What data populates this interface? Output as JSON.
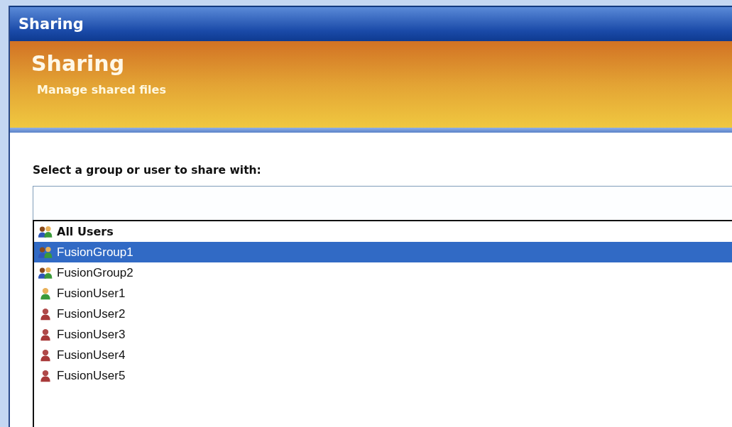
{
  "window": {
    "title": "Sharing"
  },
  "header": {
    "title": "Sharing",
    "subtitle": "Manage shared files"
  },
  "prompt": "Select a group or user to share with:",
  "items": [
    {
      "label": "All Users",
      "kind": "group",
      "bold": true,
      "selected": false
    },
    {
      "label": "FusionGroup1",
      "kind": "group",
      "bold": false,
      "selected": true
    },
    {
      "label": "FusionGroup2",
      "kind": "group",
      "bold": false,
      "selected": false
    },
    {
      "label": "FusionUser1",
      "kind": "user-active",
      "bold": false,
      "selected": false
    },
    {
      "label": "FusionUser2",
      "kind": "user",
      "bold": false,
      "selected": false
    },
    {
      "label": "FusionUser3",
      "kind": "user",
      "bold": false,
      "selected": false
    },
    {
      "label": "FusionUser4",
      "kind": "user",
      "bold": false,
      "selected": false
    },
    {
      "label": "FusionUser5",
      "kind": "user",
      "bold": false,
      "selected": false
    }
  ]
}
